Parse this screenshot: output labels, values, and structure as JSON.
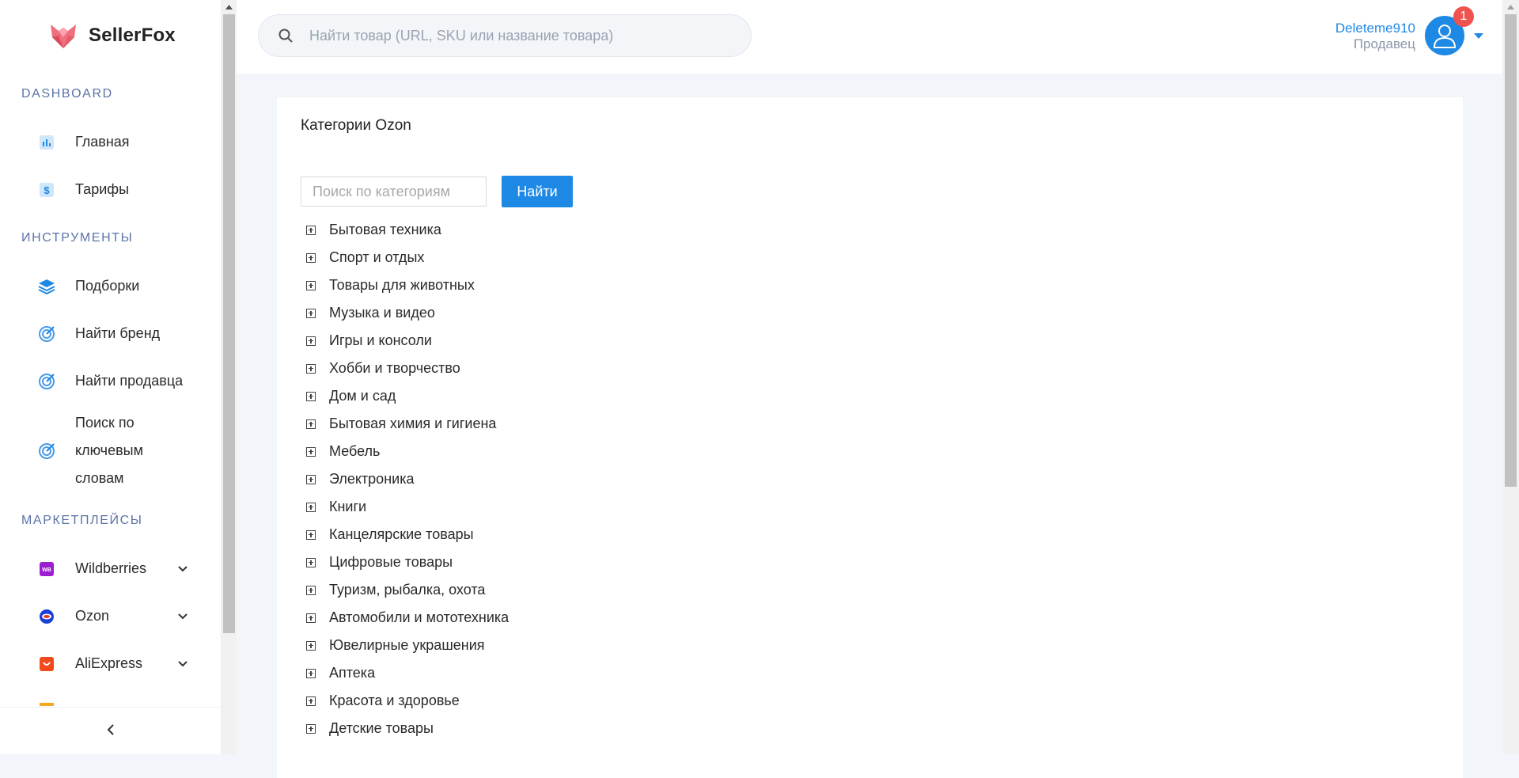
{
  "brand": {
    "name": "SellerFox"
  },
  "sidebar": {
    "sections": {
      "dashboard": "DASHBOARD",
      "tools": "ИНСТРУМЕНТЫ",
      "marketplaces": "МАРКЕТПЛЕЙСЫ"
    },
    "dashboard_items": [
      {
        "label": "Главная",
        "icon": "bar-chart-icon"
      },
      {
        "label": "Тарифы",
        "icon": "dollar-icon"
      }
    ],
    "tool_items": [
      {
        "label": "Подборки",
        "icon": "layers-icon"
      },
      {
        "label": "Найти бренд",
        "icon": "target-icon"
      },
      {
        "label": "Найти продавца",
        "icon": "target-icon"
      },
      {
        "label_lines": [
          "Поиск по",
          "ключевым",
          "словам"
        ],
        "icon": "target-icon"
      }
    ],
    "marketplace_items": [
      {
        "label": "Wildberries",
        "icon": "wildberries-icon",
        "color": "#9b1fd0"
      },
      {
        "label": "Ozon",
        "icon": "ozon-icon",
        "color": "#e53935"
      },
      {
        "label": "AliExpress",
        "icon": "aliexpress-icon",
        "color": "#f24a1d"
      }
    ]
  },
  "header": {
    "search_placeholder": "Найти товар (URL, SKU или название товара)",
    "user": {
      "name": "Deleteme910",
      "role": "Продавец",
      "notifications": "1"
    }
  },
  "main": {
    "title": "Категории Ozon",
    "category_search_placeholder": "Поиск по категориям",
    "find_button": "Найти",
    "categories": [
      "Бытовая техника",
      "Спорт и отдых",
      "Товары для животных",
      "Музыка и видео",
      "Игры и консоли",
      "Хобби и творчество",
      "Дом и сад",
      "Бытовая химия и гигиена",
      "Мебель",
      "Электроника",
      "Книги",
      "Канцелярские товары",
      "Цифровые товары",
      "Туризм, рыбалка, охота",
      "Автомобили и мототехника",
      "Ювелирные украшения",
      "Аптека",
      "Красота и здоровье",
      "Детские товары"
    ]
  },
  "colors": {
    "accent": "#1e88e5",
    "section_title": "#5b73a8",
    "badge": "#ef5350",
    "background": "#f2f6fb"
  }
}
